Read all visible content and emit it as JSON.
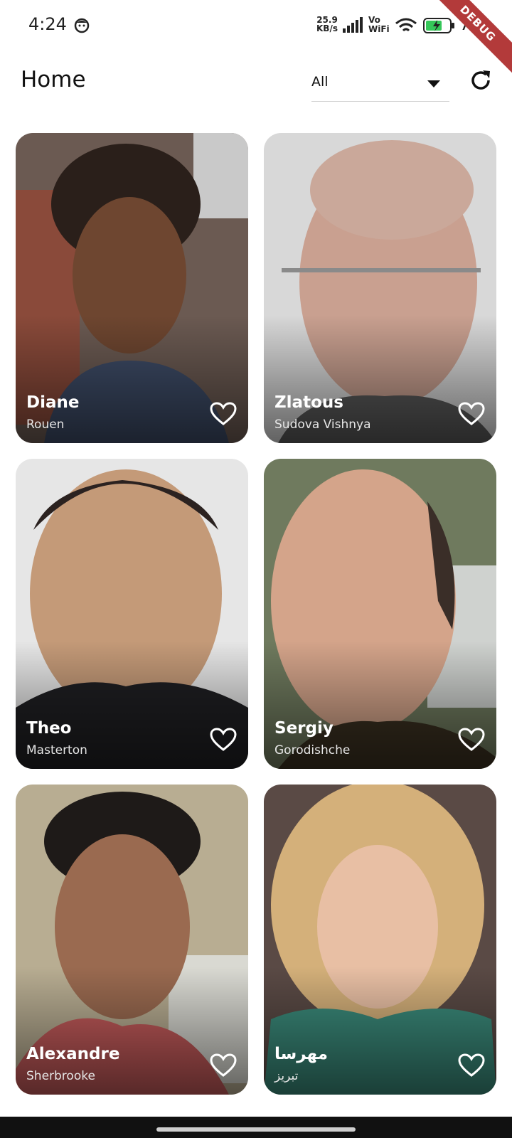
{
  "status": {
    "time": "4:24",
    "net_speed": "25.9\nKB/s",
    "vowifi": "Vo\nWiFi",
    "battery": "71",
    "debug_banner": "DEBUG"
  },
  "appbar": {
    "title": "Home",
    "filter_value": "All"
  },
  "people": [
    {
      "name": "Diane",
      "city": "Rouen"
    },
    {
      "name": "Zlatous",
      "city": "Sudova Vishnya"
    },
    {
      "name": "Theo",
      "city": "Masterton"
    },
    {
      "name": "Sergiy",
      "city": "Gorodishche"
    },
    {
      "name": "Alexandre",
      "city": "Sherbrooke"
    },
    {
      "name": "مهرسا",
      "city": "تبریز"
    }
  ],
  "colors": {
    "background": "#ffffff",
    "text": "#111111",
    "debug": "#b33a3a",
    "battery": "#35c759"
  },
  "icons": {
    "dropdown": "caret-down",
    "refresh": "refresh",
    "favorite": "heart-outline"
  }
}
